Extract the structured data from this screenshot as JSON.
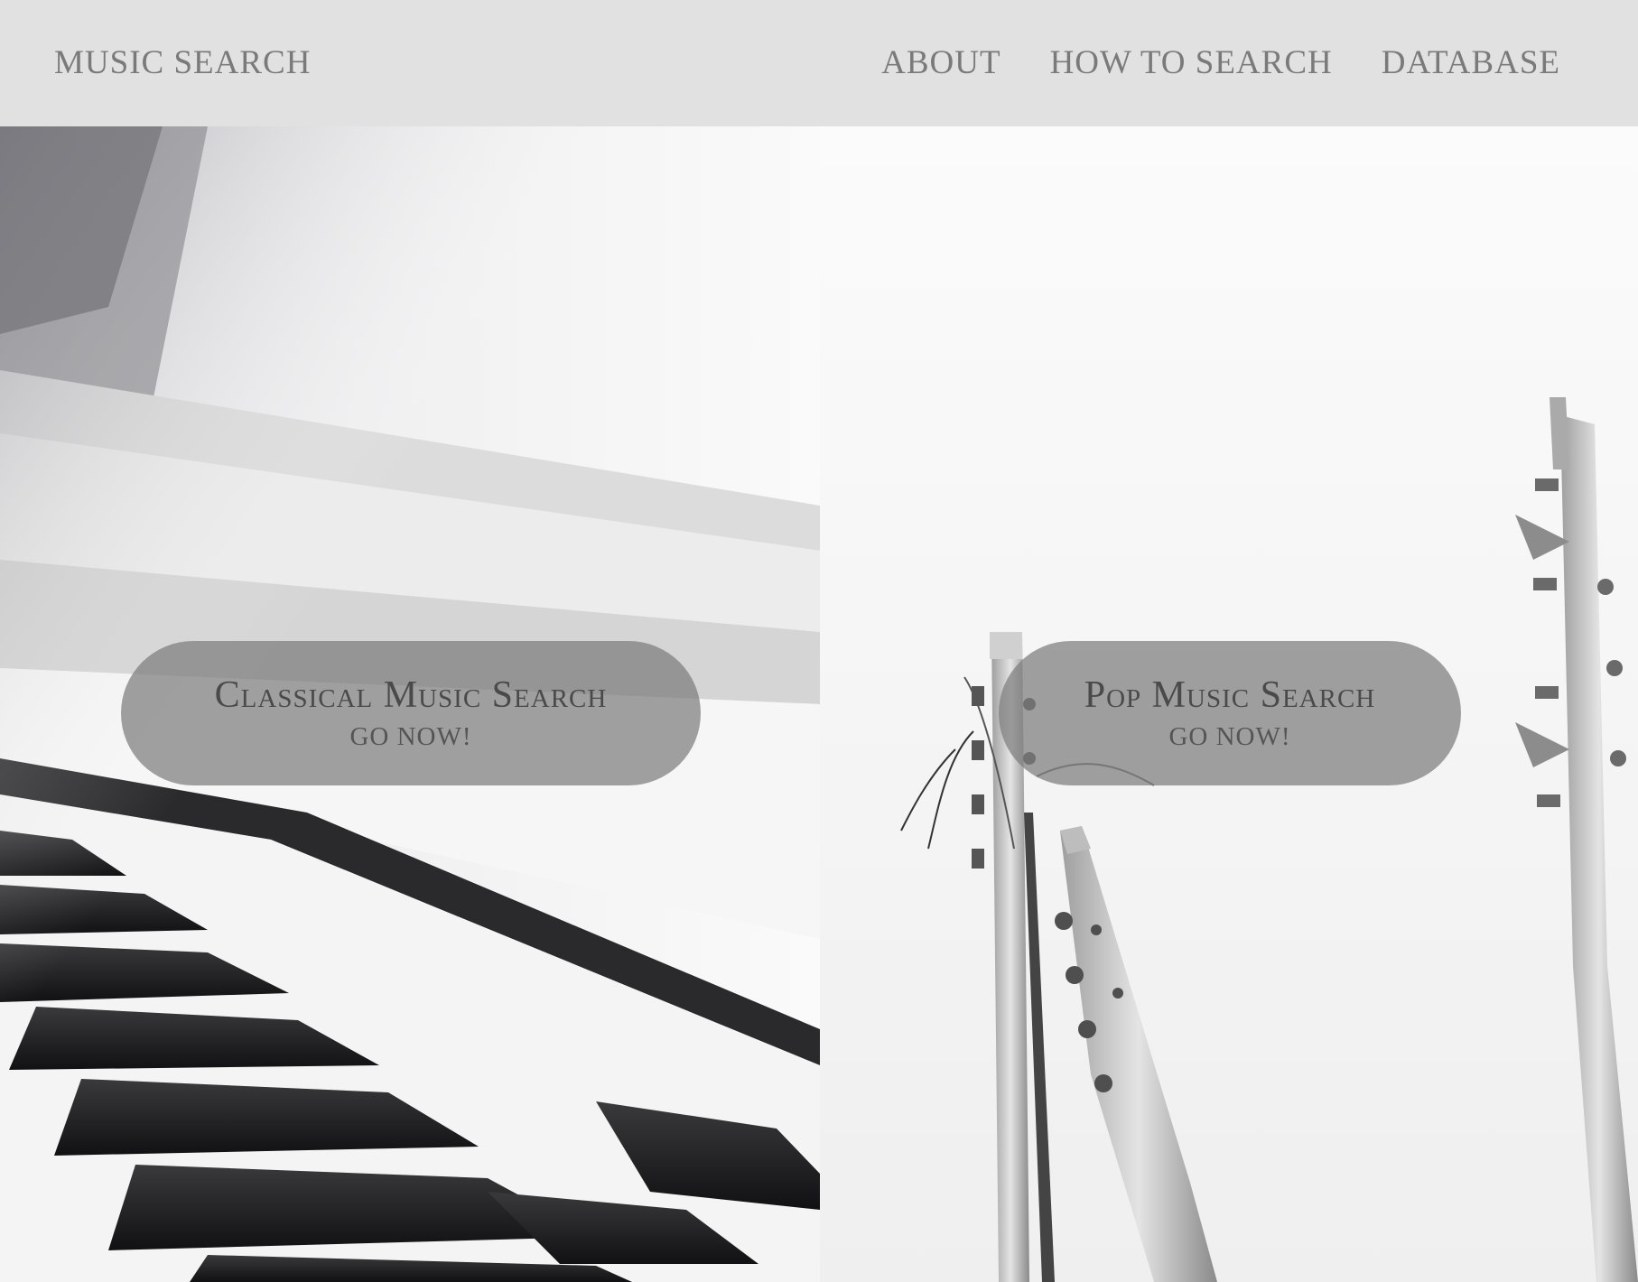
{
  "header": {
    "brand": "MUSIC SEARCH",
    "nav": [
      {
        "label": "ABOUT"
      },
      {
        "label": "HOW TO SEARCH"
      },
      {
        "label": "DATABASE"
      }
    ]
  },
  "panels": {
    "classical": {
      "title": "Classical Music Search",
      "cta": "GO NOW!",
      "image_subject": "piano-keys-photo"
    },
    "pop": {
      "title": "Pop Music Search",
      "cta": "GO NOW!",
      "image_subject": "guitar-headstocks-photo"
    }
  },
  "colors": {
    "header_bg": "#e1e1e1",
    "header_text": "#7a7a7a",
    "pill_bg": "rgba(125,125,125,0.72)",
    "pill_title": "#4a4a4a"
  }
}
